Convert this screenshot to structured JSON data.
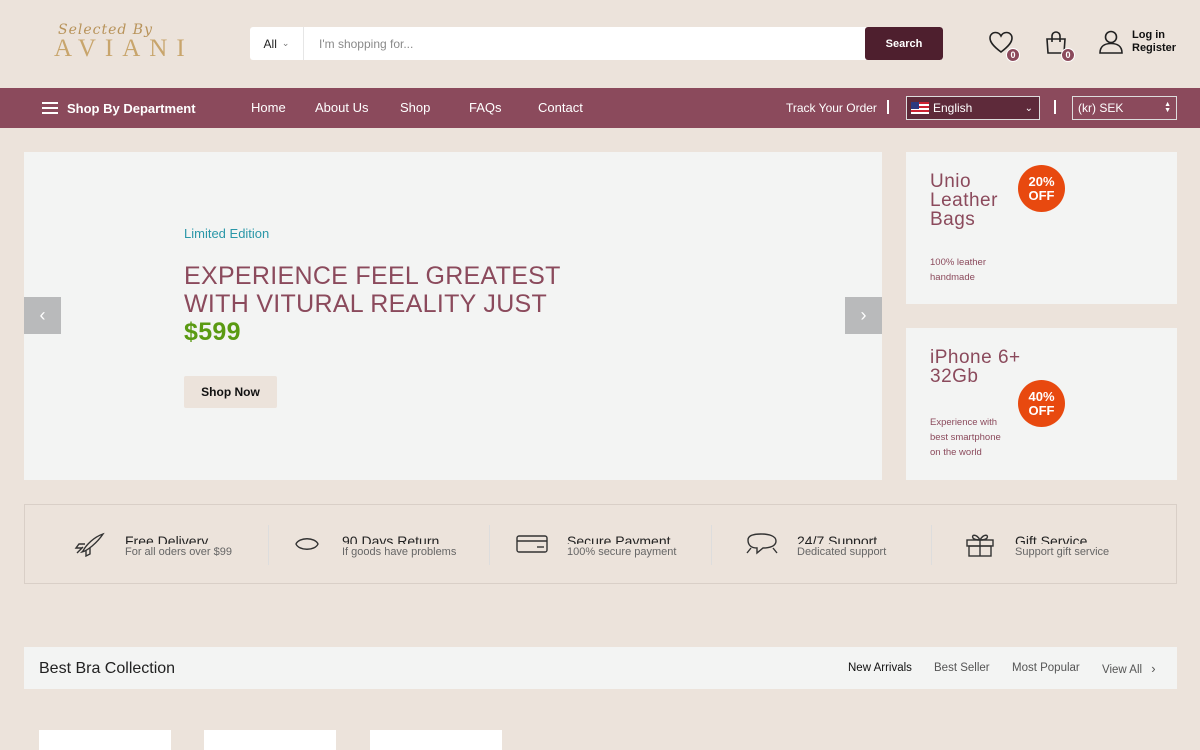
{
  "logo": {
    "script": "Selected By",
    "main": "AVIANI"
  },
  "search": {
    "category": "All",
    "placeholder": "I'm shopping for...",
    "button": "Search"
  },
  "header": {
    "wishlist_count": "0",
    "cart_count": "0",
    "login": "Log in",
    "register": "Register"
  },
  "nav": {
    "department": "Shop By Department",
    "links": [
      "Home",
      "About Us",
      "Shop",
      "FAQs",
      "Contact"
    ],
    "track": "Track Your Order",
    "language": "English",
    "currency": "(kr) SEK"
  },
  "hero": {
    "subtitle": "Limited Edition",
    "title": "EXPERIENCE FEEL GREATEST WITH VITURAL REALITY JUST",
    "price": "$599",
    "button": "Shop Now"
  },
  "promos": [
    {
      "title_line1": "Unio",
      "title_line2": "Leather",
      "title_line3": "Bags",
      "off_pct": "20%",
      "off_word": "OFF",
      "desc_line1": "100% leather",
      "desc_line2": "handmade"
    },
    {
      "title_line1": "iPhone 6+",
      "title_line2": "32Gb",
      "off_pct": "40%",
      "off_word": "OFF",
      "desc_line1": "Experience with",
      "desc_line2": "best smartphone",
      "desc_line3": "on the world"
    }
  ],
  "features": [
    {
      "icon": "rocket-icon",
      "title": "Free Delivery",
      "sub": "For all oders over $99"
    },
    {
      "icon": "return-icon",
      "title": "90 Days Return",
      "sub": "If goods have problems"
    },
    {
      "icon": "credit-card-icon",
      "title": "Secure Payment",
      "sub": "100% secure payment"
    },
    {
      "icon": "chat-icon",
      "title": "24/7 Support",
      "sub": "Dedicated support"
    },
    {
      "icon": "gift-icon",
      "title": "Gift Service",
      "sub": "Support gift service"
    }
  ],
  "collection": {
    "title": "Best Bra Collection",
    "tabs": [
      "New Arrivals",
      "Best Seller",
      "Most Popular"
    ],
    "view_all": "View All"
  },
  "colors": {
    "brand": "#8b4a5c",
    "search_button": "#4e1f2e",
    "accent_teal": "#2a97a8",
    "price_green": "#5a9a12",
    "badge_orange": "#e8490f"
  }
}
